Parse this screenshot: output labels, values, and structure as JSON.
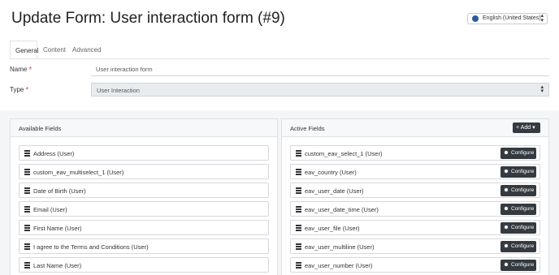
{
  "header": {
    "title": "Update Form: User interaction form (#9)",
    "language": {
      "value": "English (United States)",
      "icon": "globe-icon"
    }
  },
  "tabs": [
    {
      "label": "General",
      "active": true
    },
    {
      "label": "Content",
      "active": false
    },
    {
      "label": "Advanced",
      "active": false
    }
  ],
  "form": {
    "name": {
      "label": "Name",
      "value": "User interaction form",
      "required": "*"
    },
    "type": {
      "label": "Type",
      "value": "User Interaction",
      "required": "*"
    }
  },
  "available_fields": {
    "title": "Available Fields",
    "items": [
      "Address (User)",
      "custom_eav_multiselect_1 (User)",
      "Date of Birth (User)",
      "Email (User)",
      "First Name (User)",
      "I agree to the Terms and Conditions (User)",
      "Last Name (User)"
    ]
  },
  "active_fields": {
    "title": "Active Fields",
    "add_label": "Add",
    "configure_label": "Configure",
    "items": [
      "custom_eav_select_1 (User)",
      "eav_country (User)",
      "eav_user_date (User)",
      "eav_user_date_time (User)",
      "eav_user_file (User)",
      "eav_user_multiline (User)",
      "eav_user_number (User)"
    ]
  },
  "colors": {
    "dark_button": "#343a40",
    "required": "#d9534f",
    "page_bg": "#f4f5f7"
  }
}
